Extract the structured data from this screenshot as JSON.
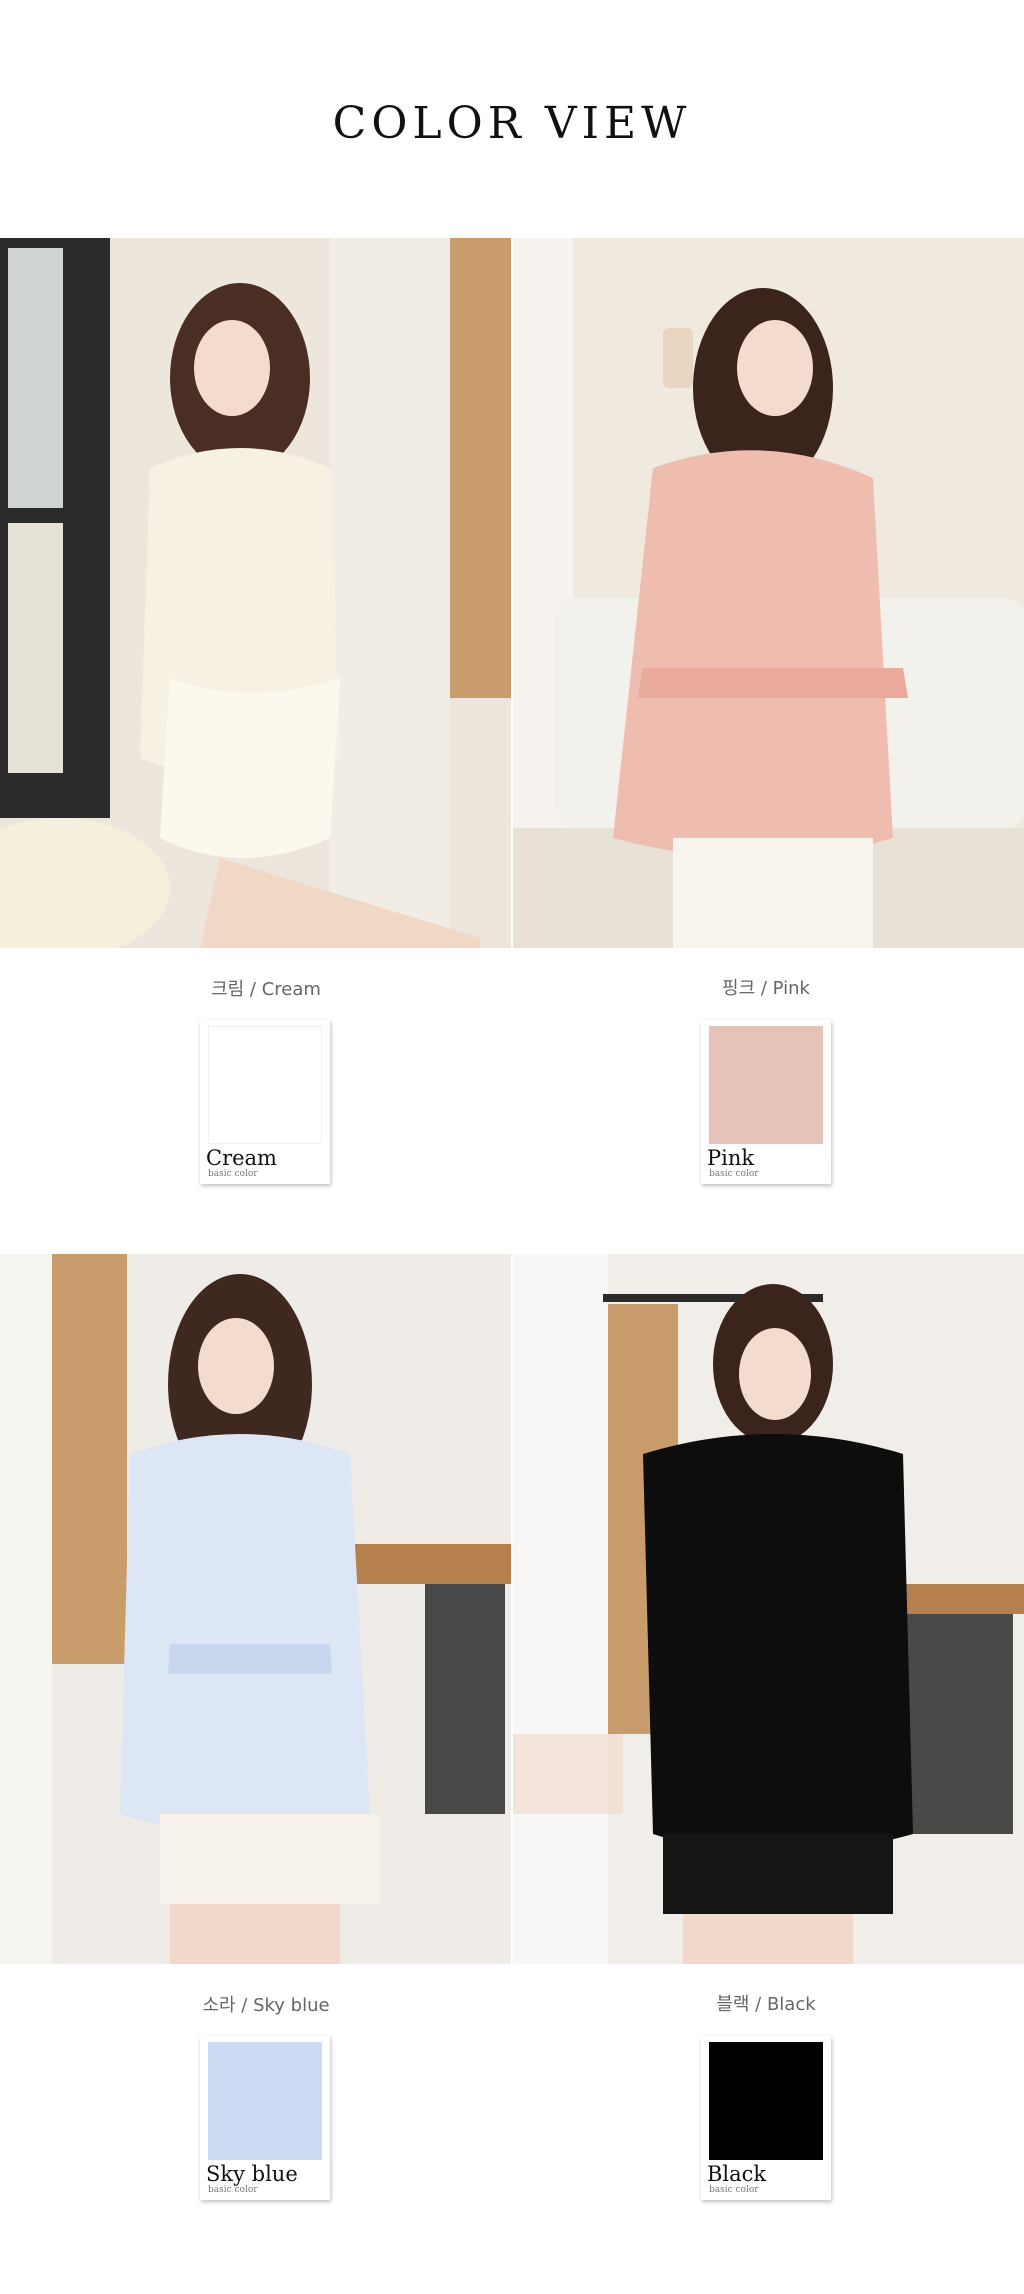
{
  "header": {
    "title": "COLOR VIEW"
  },
  "colors": [
    {
      "caption": "크림 / Cream",
      "swatch_name": "Cream",
      "swatch_sub": "basic color",
      "hex": "#ffffff"
    },
    {
      "caption": "핑크 / Pink",
      "swatch_name": "Pink",
      "swatch_sub": "basic color",
      "hex": "#e6c3b8"
    },
    {
      "caption": "소라 / Sky blue",
      "swatch_name": "Sky blue",
      "swatch_sub": "basic color",
      "hex": "#cddcf5"
    },
    {
      "caption": "블랙 / Black",
      "swatch_name": "Black",
      "swatch_sub": "basic color",
      "hex": "#000000"
    }
  ]
}
